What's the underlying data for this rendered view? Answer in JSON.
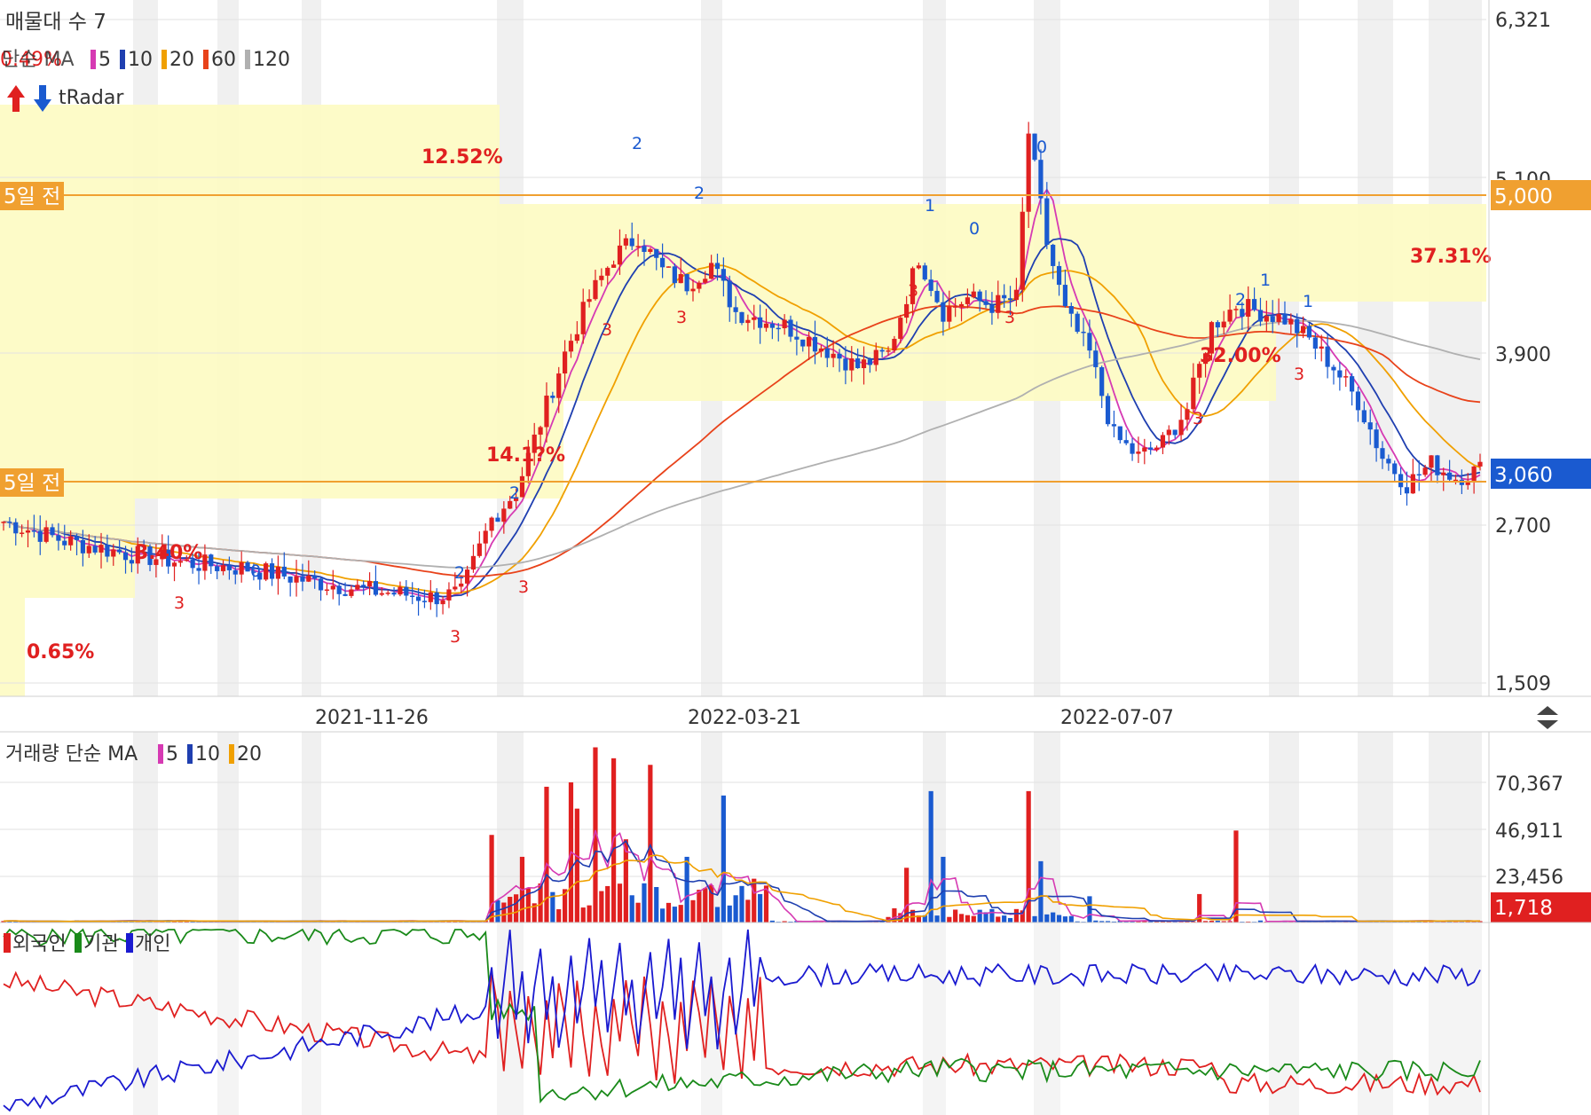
{
  "price_panel": {
    "title": "매물대 수 7",
    "ma_prefix_overlap": "0.49%",
    "ma_label": "단순 MA",
    "ma_periods": [
      "5",
      "10",
      "20",
      "60",
      "120"
    ],
    "ma_colors": [
      "#d63ab3",
      "#1f3fb0",
      "#f0a000",
      "#e8421a",
      "#b0b0b0"
    ],
    "radar_label": "tRadar",
    "y_ticks": [
      "6,321",
      "5,100",
      "3,900",
      "2,700",
      "1,509"
    ],
    "ref_line_upper": {
      "label": "5일 전",
      "price_tag": "5,000"
    },
    "ref_line_lower": {
      "label": "5일 전",
      "price_tag": "3,060"
    },
    "percent_labels": [
      "12.52%",
      "37.31%",
      "14.1?%",
      "32.00%",
      "3.40%",
      "0.65%"
    ],
    "signal_digits": [
      "0",
      "1",
      "2",
      "3"
    ]
  },
  "x_axis": {
    "dates": [
      "2021-11-26",
      "2022-03-21",
      "2022-07-07"
    ]
  },
  "volume_panel": {
    "title": "거래량 단순 MA",
    "ma_periods": [
      "5",
      "10",
      "20"
    ],
    "ma_colors": [
      "#d63ab3",
      "#1f3fb0",
      "#f0a000"
    ],
    "y_ticks": [
      "70,367",
      "46,911",
      "23,456"
    ],
    "last_volume_tag": "1,718"
  },
  "investor_panel": {
    "legend": [
      "외국인",
      "기관",
      "개인"
    ],
    "colors": [
      "#e02020",
      "#1a8a1a",
      "#1a1ad0"
    ]
  },
  "chart_data": [
    {
      "type": "candlestick",
      "title": "매물대 수 7",
      "x_ticks": [
        "2021-11-26",
        "2022-03-21",
        "2022-07-07"
      ],
      "y_ticks": [
        6321,
        5100,
        3900,
        2700,
        1509
      ],
      "ylim": [
        1509,
        6321
      ],
      "approx_close_path": [
        [
          0,
          2680
        ],
        [
          10,
          2540
        ],
        [
          20,
          2450
        ],
        [
          30,
          2380
        ],
        [
          40,
          2340
        ],
        [
          50,
          2250
        ],
        [
          60,
          2180
        ],
        [
          70,
          2130
        ],
        [
          75,
          2160
        ],
        [
          80,
          2700
        ],
        [
          84,
          2900
        ],
        [
          88,
          3400
        ],
        [
          92,
          3900
        ],
        [
          96,
          4300
        ],
        [
          100,
          4600
        ],
        [
          104,
          4750
        ],
        [
          108,
          4500
        ],
        [
          112,
          4400
        ],
        [
          116,
          4550
        ],
        [
          120,
          4200
        ],
        [
          124,
          4150
        ],
        [
          128,
          4100
        ],
        [
          132,
          4000
        ],
        [
          136,
          3900
        ],
        [
          140,
          3800
        ],
        [
          145,
          3900
        ],
        [
          150,
          4600
        ],
        [
          154,
          4200
        ],
        [
          158,
          4300
        ],
        [
          162,
          4250
        ],
        [
          166,
          4300
        ],
        [
          168,
          5500
        ],
        [
          171,
          4700
        ],
        [
          174,
          4200
        ],
        [
          178,
          3900
        ],
        [
          182,
          3300
        ],
        [
          186,
          3150
        ],
        [
          190,
          3250
        ],
        [
          194,
          3500
        ],
        [
          198,
          4100
        ],
        [
          202,
          4250
        ],
        [
          206,
          4200
        ],
        [
          210,
          4150
        ],
        [
          214,
          4000
        ],
        [
          218,
          3800
        ],
        [
          222,
          3550
        ],
        [
          226,
          3150
        ],
        [
          230,
          2950
        ],
        [
          234,
          3100
        ],
        [
          238,
          3000
        ],
        [
          242,
          3060
        ]
      ],
      "ma_series": [
        "5",
        "10",
        "20",
        "60",
        "120"
      ],
      "ref_lines": [
        5000,
        3060
      ]
    },
    {
      "type": "bar",
      "title": "거래량 단순 MA",
      "y_ticks": [
        70367,
        46911,
        23456
      ],
      "last_value": 1718
    },
    {
      "type": "line",
      "series": [
        {
          "name": "외국인"
        },
        {
          "name": "기관"
        },
        {
          "name": "개인"
        }
      ]
    }
  ]
}
